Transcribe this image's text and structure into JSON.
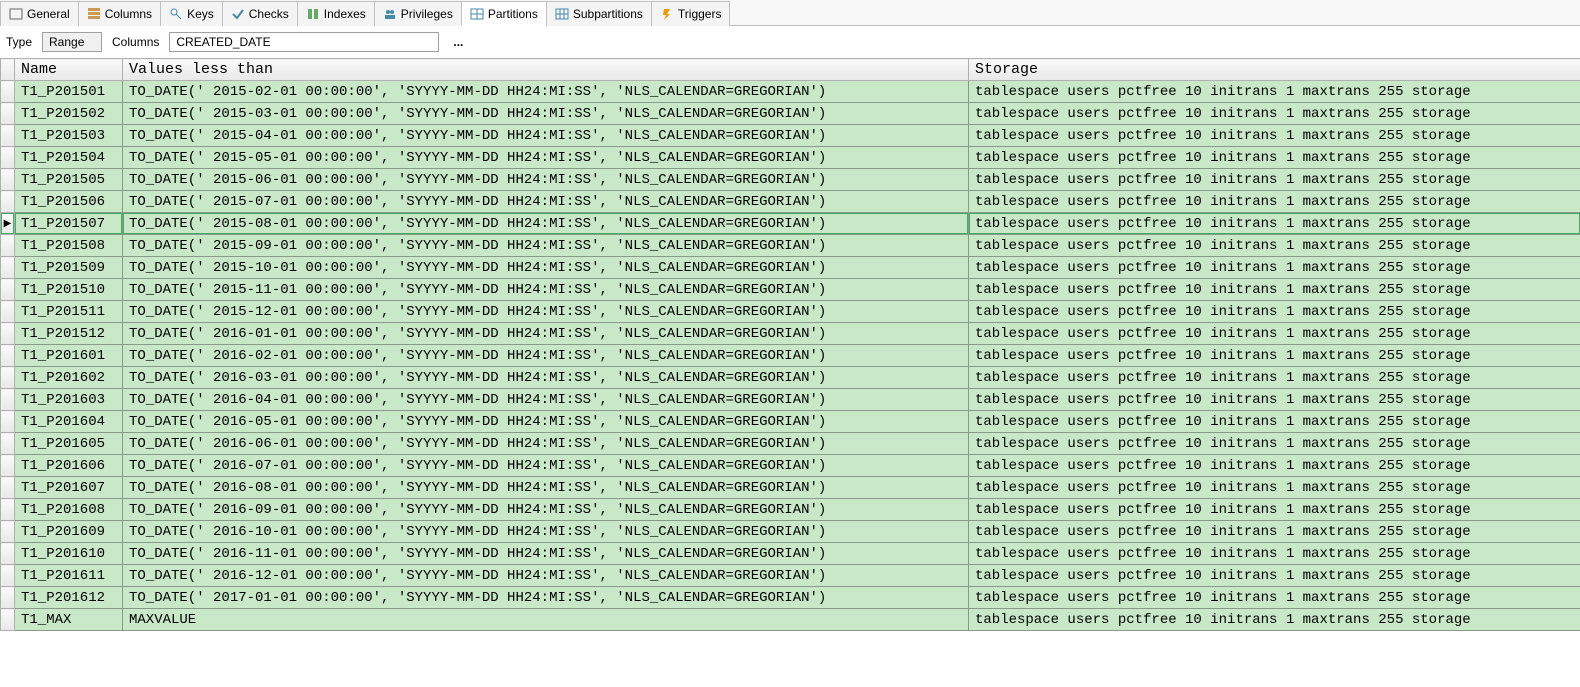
{
  "tabs": [
    {
      "label": "General"
    },
    {
      "label": "Columns"
    },
    {
      "label": "Keys"
    },
    {
      "label": "Checks"
    },
    {
      "label": "Indexes"
    },
    {
      "label": "Privileges"
    },
    {
      "label": "Partitions",
      "active": true
    },
    {
      "label": "Subpartitions"
    },
    {
      "label": "Triggers"
    }
  ],
  "filter": {
    "type_label": "Type",
    "type_value": "Range",
    "columns_label": "Columns",
    "columns_value": "CREATED_DATE",
    "ellipsis": "..."
  },
  "columns": {
    "name": "Name",
    "values": "Values less than",
    "storage": "Storage"
  },
  "selected_row_index": 6,
  "rows": [
    {
      "name": "T1_P201501",
      "values": "TO_DATE(' 2015-02-01 00:00:00', 'SYYYY-MM-DD HH24:MI:SS', 'NLS_CALENDAR=GREGORIAN')",
      "storage": "tablespace users pctfree 10 initrans 1 maxtrans 255 storage"
    },
    {
      "name": "T1_P201502",
      "values": "TO_DATE(' 2015-03-01 00:00:00', 'SYYYY-MM-DD HH24:MI:SS', 'NLS_CALENDAR=GREGORIAN')",
      "storage": "tablespace users pctfree 10 initrans 1 maxtrans 255 storage"
    },
    {
      "name": "T1_P201503",
      "values": "TO_DATE(' 2015-04-01 00:00:00', 'SYYYY-MM-DD HH24:MI:SS', 'NLS_CALENDAR=GREGORIAN')",
      "storage": "tablespace users pctfree 10 initrans 1 maxtrans 255 storage"
    },
    {
      "name": "T1_P201504",
      "values": "TO_DATE(' 2015-05-01 00:00:00', 'SYYYY-MM-DD HH24:MI:SS', 'NLS_CALENDAR=GREGORIAN')",
      "storage": "tablespace users pctfree 10 initrans 1 maxtrans 255 storage"
    },
    {
      "name": "T1_P201505",
      "values": "TO_DATE(' 2015-06-01 00:00:00', 'SYYYY-MM-DD HH24:MI:SS', 'NLS_CALENDAR=GREGORIAN')",
      "storage": "tablespace users pctfree 10 initrans 1 maxtrans 255 storage"
    },
    {
      "name": "T1_P201506",
      "values": "TO_DATE(' 2015-07-01 00:00:00', 'SYYYY-MM-DD HH24:MI:SS', 'NLS_CALENDAR=GREGORIAN')",
      "storage": "tablespace users pctfree 10 initrans 1 maxtrans 255 storage"
    },
    {
      "name": "T1_P201507",
      "values": "TO_DATE(' 2015-08-01 00:00:00', 'SYYYY-MM-DD HH24:MI:SS', 'NLS_CALENDAR=GREGORIAN')",
      "storage": "tablespace users pctfree 10 initrans 1 maxtrans 255 storage"
    },
    {
      "name": "T1_P201508",
      "values": "TO_DATE(' 2015-09-01 00:00:00', 'SYYYY-MM-DD HH24:MI:SS', 'NLS_CALENDAR=GREGORIAN')",
      "storage": "tablespace users pctfree 10 initrans 1 maxtrans 255 storage"
    },
    {
      "name": "T1_P201509",
      "values": "TO_DATE(' 2015-10-01 00:00:00', 'SYYYY-MM-DD HH24:MI:SS', 'NLS_CALENDAR=GREGORIAN')",
      "storage": "tablespace users pctfree 10 initrans 1 maxtrans 255 storage"
    },
    {
      "name": "T1_P201510",
      "values": "TO_DATE(' 2015-11-01 00:00:00', 'SYYYY-MM-DD HH24:MI:SS', 'NLS_CALENDAR=GREGORIAN')",
      "storage": "tablespace users pctfree 10 initrans 1 maxtrans 255 storage"
    },
    {
      "name": "T1_P201511",
      "values": "TO_DATE(' 2015-12-01 00:00:00', 'SYYYY-MM-DD HH24:MI:SS', 'NLS_CALENDAR=GREGORIAN')",
      "storage": "tablespace users pctfree 10 initrans 1 maxtrans 255 storage"
    },
    {
      "name": "T1_P201512",
      "values": "TO_DATE(' 2016-01-01 00:00:00', 'SYYYY-MM-DD HH24:MI:SS', 'NLS_CALENDAR=GREGORIAN')",
      "storage": "tablespace users pctfree 10 initrans 1 maxtrans 255 storage"
    },
    {
      "name": "T1_P201601",
      "values": "TO_DATE(' 2016-02-01 00:00:00', 'SYYYY-MM-DD HH24:MI:SS', 'NLS_CALENDAR=GREGORIAN')",
      "storage": "tablespace users pctfree 10 initrans 1 maxtrans 255 storage"
    },
    {
      "name": "T1_P201602",
      "values": "TO_DATE(' 2016-03-01 00:00:00', 'SYYYY-MM-DD HH24:MI:SS', 'NLS_CALENDAR=GREGORIAN')",
      "storage": "tablespace users pctfree 10 initrans 1 maxtrans 255 storage"
    },
    {
      "name": "T1_P201603",
      "values": "TO_DATE(' 2016-04-01 00:00:00', 'SYYYY-MM-DD HH24:MI:SS', 'NLS_CALENDAR=GREGORIAN')",
      "storage": "tablespace users pctfree 10 initrans 1 maxtrans 255 storage"
    },
    {
      "name": "T1_P201604",
      "values": "TO_DATE(' 2016-05-01 00:00:00', 'SYYYY-MM-DD HH24:MI:SS', 'NLS_CALENDAR=GREGORIAN')",
      "storage": "tablespace users pctfree 10 initrans 1 maxtrans 255 storage"
    },
    {
      "name": "T1_P201605",
      "values": "TO_DATE(' 2016-06-01 00:00:00', 'SYYYY-MM-DD HH24:MI:SS', 'NLS_CALENDAR=GREGORIAN')",
      "storage": "tablespace users pctfree 10 initrans 1 maxtrans 255 storage"
    },
    {
      "name": "T1_P201606",
      "values": "TO_DATE(' 2016-07-01 00:00:00', 'SYYYY-MM-DD HH24:MI:SS', 'NLS_CALENDAR=GREGORIAN')",
      "storage": "tablespace users pctfree 10 initrans 1 maxtrans 255 storage"
    },
    {
      "name": "T1_P201607",
      "values": "TO_DATE(' 2016-08-01 00:00:00', 'SYYYY-MM-DD HH24:MI:SS', 'NLS_CALENDAR=GREGORIAN')",
      "storage": "tablespace users pctfree 10 initrans 1 maxtrans 255 storage"
    },
    {
      "name": "T1_P201608",
      "values": "TO_DATE(' 2016-09-01 00:00:00', 'SYYYY-MM-DD HH24:MI:SS', 'NLS_CALENDAR=GREGORIAN')",
      "storage": "tablespace users pctfree 10 initrans 1 maxtrans 255 storage"
    },
    {
      "name": "T1_P201609",
      "values": "TO_DATE(' 2016-10-01 00:00:00', 'SYYYY-MM-DD HH24:MI:SS', 'NLS_CALENDAR=GREGORIAN')",
      "storage": "tablespace users pctfree 10 initrans 1 maxtrans 255 storage"
    },
    {
      "name": "T1_P201610",
      "values": "TO_DATE(' 2016-11-01 00:00:00', 'SYYYY-MM-DD HH24:MI:SS', 'NLS_CALENDAR=GREGORIAN')",
      "storage": "tablespace users pctfree 10 initrans 1 maxtrans 255 storage"
    },
    {
      "name": "T1_P201611",
      "values": "TO_DATE(' 2016-12-01 00:00:00', 'SYYYY-MM-DD HH24:MI:SS', 'NLS_CALENDAR=GREGORIAN')",
      "storage": "tablespace users pctfree 10 initrans 1 maxtrans 255 storage"
    },
    {
      "name": "T1_P201612",
      "values": "TO_DATE(' 2017-01-01 00:00:00', 'SYYYY-MM-DD HH24:MI:SS', 'NLS_CALENDAR=GREGORIAN')",
      "storage": "tablespace users pctfree 10 initrans 1 maxtrans 255 storage"
    },
    {
      "name": "T1_MAX",
      "values": "MAXVALUE",
      "storage": "tablespace users pctfree 10 initrans 1 maxtrans 255 storage"
    }
  ]
}
